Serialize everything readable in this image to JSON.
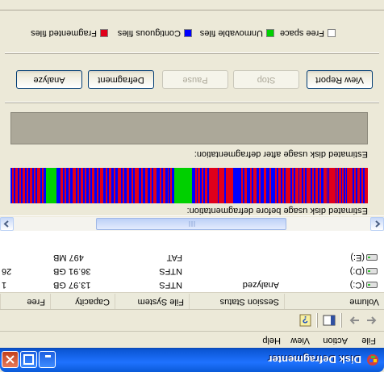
{
  "window": {
    "title": "Disk Defragmenter"
  },
  "menu": [
    "File",
    "Action",
    "View",
    "Help"
  ],
  "columns": [
    "Volume",
    "Session Status",
    "File System",
    "Capacity",
    "Free"
  ],
  "volumes": [
    {
      "volume": "(C:)",
      "status": "Analyzed",
      "fs": "NTFS",
      "capacity": "13.97 GB",
      "free": "1"
    },
    {
      "volume": "(D:)",
      "status": "",
      "fs": "NTFS",
      "capacity": "36.91 GB",
      "free": "26"
    },
    {
      "volume": "(E:)",
      "status": "",
      "fs": "FAT",
      "capacity": "497 MB",
      "free": ""
    }
  ],
  "labels": {
    "before": "Estimated disk usage before defragmentation:",
    "after": "Estimated disk usage after defragmentation:"
  },
  "buttons": {
    "analyze": "Analyze",
    "defragment": "Defragment",
    "pause": "Pause",
    "stop": "Stop",
    "view_report": "View Report"
  },
  "legend": {
    "fragmented": "Fragmented files",
    "contiguous": "Contiguous files",
    "unmovable": "Unmovable files",
    "free": "Free space"
  },
  "colors": {
    "fragmented": "#e0001a",
    "contiguous": "#0000ff",
    "unmovable": "#00d000",
    "free": "#ffffff",
    "after_bar": "#aca899"
  },
  "icons": {
    "back": "back-arrow-icon",
    "forward": "forward-arrow-icon",
    "show_hide": "show-hide-console-tree-icon",
    "help": "help-icon",
    "drive": "hard-drive-icon",
    "app": "disk-defragmenter-icon"
  }
}
